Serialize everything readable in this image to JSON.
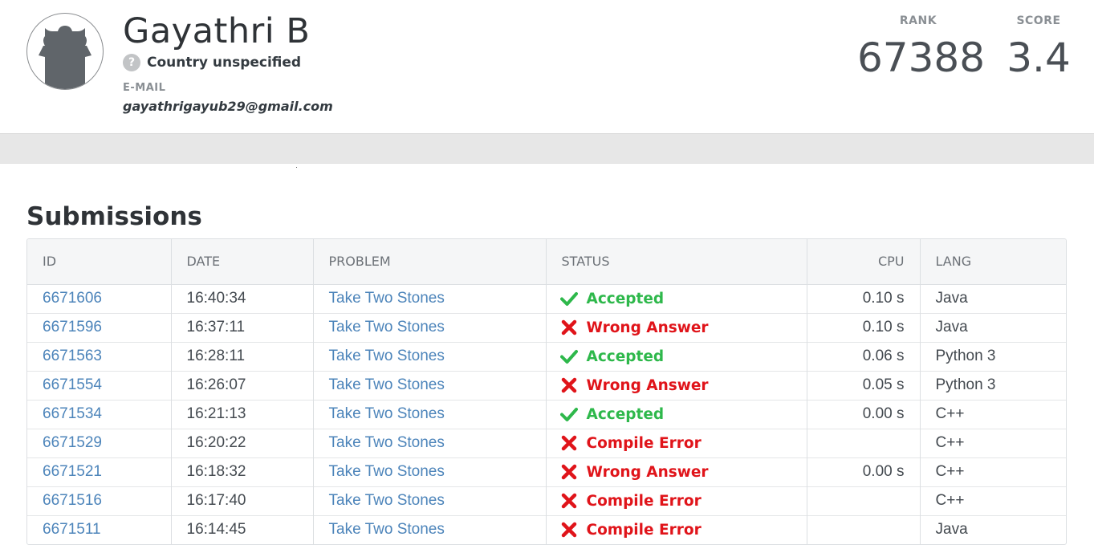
{
  "profile": {
    "name": "Gayathri B",
    "country": "Country unspecified",
    "country_icon": "question-mark-icon",
    "email_label": "E-MAIL",
    "email": "gayathrigayub29@gmail.com",
    "rank_label": "RANK",
    "rank": "67388",
    "score_label": "SCORE",
    "score": "3.4"
  },
  "submissions": {
    "title": "Submissions",
    "columns": {
      "id": "ID",
      "date": "DATE",
      "problem": "PROBLEM",
      "status": "STATUS",
      "cpu": "CPU",
      "lang": "LANG"
    },
    "rows": [
      {
        "id": "6671606",
        "date": "16:40:34",
        "problem": "Take Two Stones",
        "status": "Accepted",
        "ok": true,
        "cpu": "0.10 s",
        "lang": "Java"
      },
      {
        "id": "6671596",
        "date": "16:37:11",
        "problem": "Take Two Stones",
        "status": "Wrong Answer",
        "ok": false,
        "cpu": "0.10 s",
        "lang": "Java"
      },
      {
        "id": "6671563",
        "date": "16:28:11",
        "problem": "Take Two Stones",
        "status": "Accepted",
        "ok": true,
        "cpu": "0.06 s",
        "lang": "Python 3"
      },
      {
        "id": "6671554",
        "date": "16:26:07",
        "problem": "Take Two Stones",
        "status": "Wrong Answer",
        "ok": false,
        "cpu": "0.05 s",
        "lang": "Python 3"
      },
      {
        "id": "6671534",
        "date": "16:21:13",
        "problem": "Take Two Stones",
        "status": "Accepted",
        "ok": true,
        "cpu": "0.00 s",
        "lang": "C++"
      },
      {
        "id": "6671529",
        "date": "16:20:22",
        "problem": "Take Two Stones",
        "status": "Compile Error",
        "ok": false,
        "cpu": "",
        "lang": "C++"
      },
      {
        "id": "6671521",
        "date": "16:18:32",
        "problem": "Take Two Stones",
        "status": "Wrong Answer",
        "ok": false,
        "cpu": "0.00 s",
        "lang": "C++"
      },
      {
        "id": "6671516",
        "date": "16:17:40",
        "problem": "Take Two Stones",
        "status": "Compile Error",
        "ok": false,
        "cpu": "",
        "lang": "C++"
      },
      {
        "id": "6671511",
        "date": "16:14:45",
        "problem": "Take Two Stones",
        "status": "Compile Error",
        "ok": false,
        "cpu": "",
        "lang": "Java"
      }
    ]
  },
  "colors": {
    "link": "#4c84ba",
    "accepted": "#2eb84b",
    "rejected": "#e0141a",
    "band": "#e7e7e7"
  },
  "icons": {
    "accepted": "check-icon",
    "rejected": "cross-icon",
    "avatar": "default-avatar-icon"
  }
}
